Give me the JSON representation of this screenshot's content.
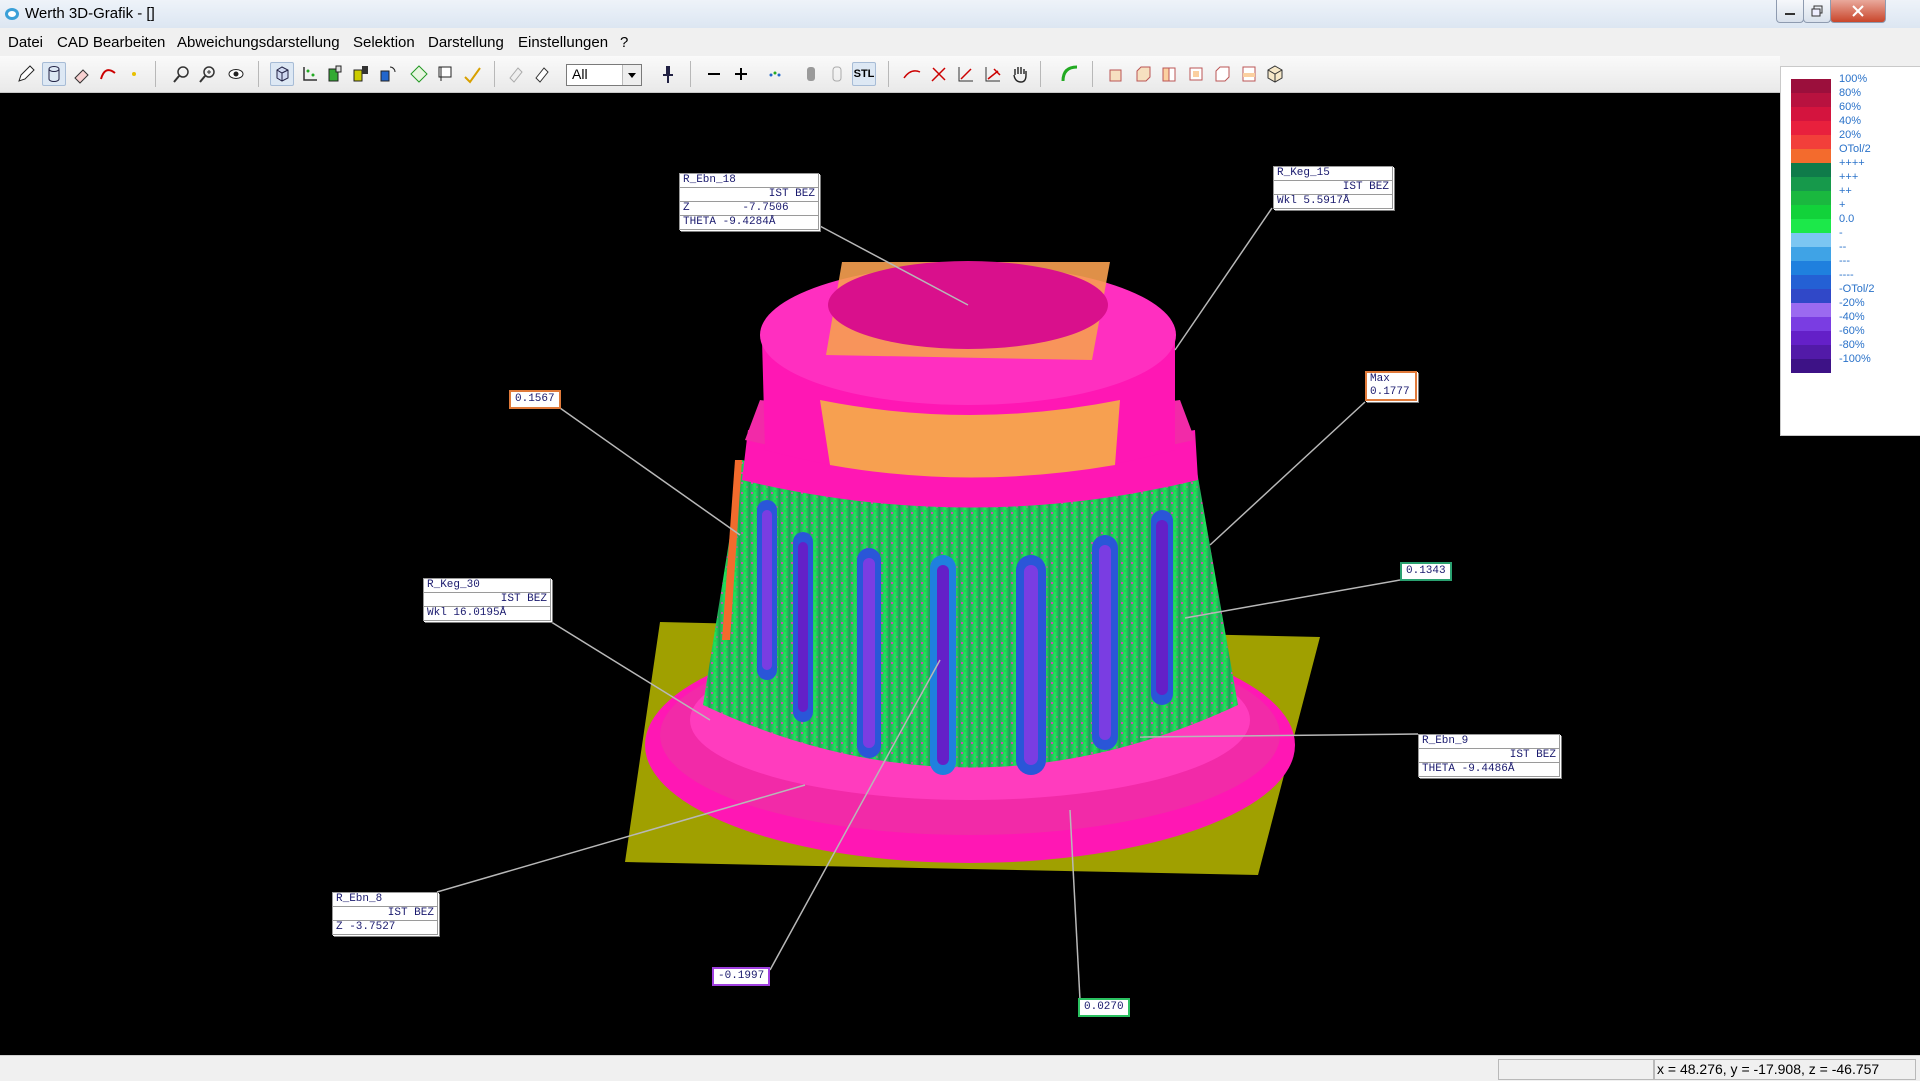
{
  "window": {
    "title": "Werth 3D-Grafik - []"
  },
  "menu": [
    "Datei",
    "CAD Bearbeiten",
    "Abweichungsdarstellung",
    "Selektion",
    "Darstellung",
    "Einstellungen",
    "?"
  ],
  "toolbar": {
    "filter_value": "All",
    "stl_label": "STL",
    "buttons": [
      "edit-icon",
      "cylinder-icon",
      "eraser-icon",
      "curve-icon",
      "point-icon",
      "zoom-window-icon",
      "zoom-fit-icon",
      "eye-icon",
      "view-cube-icon",
      "axes-icon",
      "slice-icon",
      "section-icon",
      "section-rotate-icon",
      "element-icon",
      "flag-icon",
      "pen-icon",
      "hidden-icon",
      "erase-icon",
      "pin-icon",
      "minus-icon",
      "plus-icon",
      "point-cloud-icon",
      "grey-cylinder-icon",
      "outline-cylinder-icon",
      "measure-icon",
      "axis-x-icon",
      "axis-xy-icon",
      "axis-xyz-icon",
      "hand-icon",
      "surface-icon",
      "view-front-icon",
      "view-back-icon",
      "view-left-icon",
      "view-right-icon",
      "view-top-icon",
      "view-iso-icon"
    ]
  },
  "legend": {
    "items": [
      {
        "label": "100%",
        "color": "#9b0f3c"
      },
      {
        "label": "80%",
        "color": "#b8123f"
      },
      {
        "label": "60%",
        "color": "#d4143e"
      },
      {
        "label": "40%",
        "color": "#e8203d"
      },
      {
        "label": "20%",
        "color": "#f23f3a"
      },
      {
        "label": "OTol/2",
        "color": "#f36b2d"
      },
      {
        "label": "++++",
        "color": "#0f7b4a"
      },
      {
        "label": "+++",
        "color": "#16994b"
      },
      {
        "label": "++",
        "color": "#1ab83f"
      },
      {
        "label": "+",
        "color": "#12d23a"
      },
      {
        "label": "0.0",
        "color": "#1ce84a"
      },
      {
        "label": "-",
        "color": "#7cc6f2"
      },
      {
        "label": "--",
        "color": "#3fa3e6"
      },
      {
        "label": "---",
        "color": "#1f80de"
      },
      {
        "label": "----",
        "color": "#2460d4"
      },
      {
        "label": "-OTol/2",
        "color": "#3048c8"
      },
      {
        "label": "-20%",
        "color": "#9b6af0"
      },
      {
        "label": "-40%",
        "color": "#7a3de2"
      },
      {
        "label": "-60%",
        "color": "#6420c8"
      },
      {
        "label": "-80%",
        "color": "#521aa8"
      },
      {
        "label": "-100%",
        "color": "#3d1286"
      }
    ]
  },
  "annotations": {
    "r_ebn_18": {
      "name": "R_Ebn_18",
      "header": "IST BEZ",
      "rows": [
        "Z        -7.7506",
        "THETA -9.4284Å"
      ]
    },
    "r_keg_15": {
      "name": "R_Keg_15",
      "header": "IST BEZ",
      "rows": [
        "Wkl 5.5917Å"
      ]
    },
    "r_keg_30": {
      "name": "R_Keg_30",
      "header": "IST BEZ",
      "rows": [
        "Wkl 16.0195Å"
      ]
    },
    "r_ebn_9": {
      "name": "R_Ebn_9",
      "header": "IST BEZ",
      "rows": [
        "THETA -9.4486Å"
      ]
    },
    "r_ebn_8": {
      "name": "R_Ebn_8",
      "header": "IST BEZ",
      "rows": [
        "Z -3.7527"
      ]
    },
    "max": {
      "name": "Max",
      "value": "0.1777"
    },
    "v_0_1567": "0.1567",
    "v_0_1343": "0.1343",
    "v_m0_1997": "-0.1997",
    "v_0_0270": "0.0270"
  },
  "status": {
    "coords": "x = 48.276, y = -17.908, z = -46.757"
  }
}
